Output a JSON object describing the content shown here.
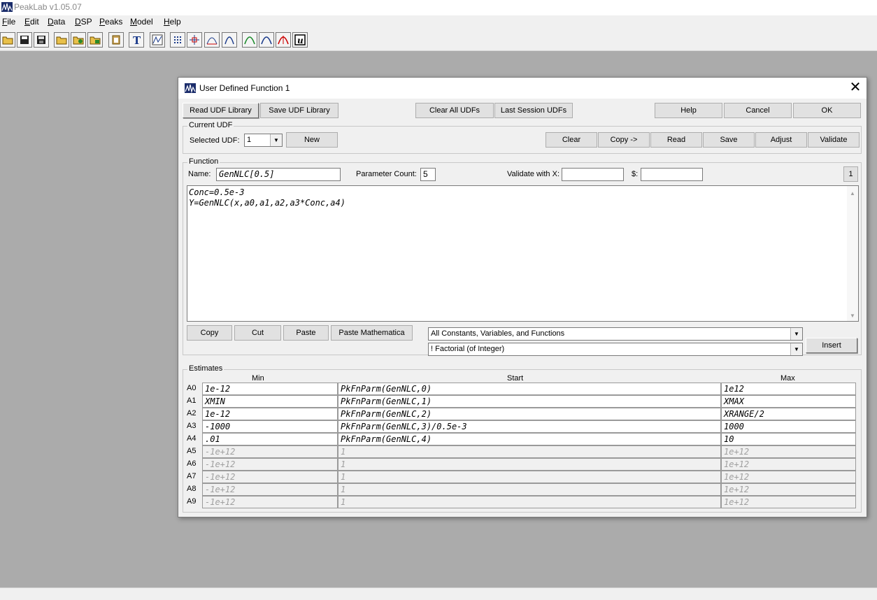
{
  "app": {
    "title": "PeakLab v1.05.07"
  },
  "menu": [
    {
      "label": "File",
      "ul": "F",
      "rest": "ile"
    },
    {
      "label": "Edit",
      "ul": "E",
      "rest": "dit"
    },
    {
      "label": "Data",
      "ul": "D",
      "rest": "ata"
    },
    {
      "label": "DSP",
      "ul": "D",
      "rest": "SP"
    },
    {
      "label": "Peaks",
      "ul": "P",
      "rest": "eaks"
    },
    {
      "label": "Model",
      "ul": "M",
      "rest": "odel"
    },
    {
      "label": "Help",
      "ul": "H",
      "rest": "elp"
    }
  ],
  "toolbar_icons": [
    "open-folder-icon",
    "save-disk-icon",
    "save-all-icon",
    "open-file-icon",
    "open-data-icon",
    "open-workspace-icon",
    "clipboard-icon",
    "text-tool-icon",
    "chart-view-icon",
    "grid-points-icon",
    "crosshair-icon",
    "baseline-peak-icon",
    "single-peak-icon",
    "gaussian-peak-icon",
    "peak-fit-icon",
    "red-peak-icon",
    "udf-icon"
  ],
  "dialog": {
    "title": "User Defined Function 1",
    "top_buttons": {
      "read_library": "Read UDF Library",
      "save_library": "Save UDF Library",
      "clear_all": "Clear All UDFs",
      "last_session": "Last Session UDFs",
      "help": "Help",
      "cancel": "Cancel",
      "ok": "OK"
    },
    "current_udf": {
      "legend": "Current UDF",
      "selected_label": "Selected UDF:",
      "selected_value": "1",
      "new": "New",
      "clear": "Clear",
      "copy": "Copy ->",
      "read": "Read",
      "save": "Save",
      "adjust": "Adjust",
      "validate": "Validate"
    },
    "function": {
      "legend": "Function",
      "name_label": "Name:",
      "name_value": "GenNLC[0.5]",
      "param_count_label": "Parameter Count:",
      "param_count_value": "5",
      "validate_x_label": "Validate with X:",
      "validate_x_value": "",
      "dollar_label": "$:",
      "dollar_value": "",
      "page_button": "1",
      "code_lines": [
        "Conc=0.5e-3",
        "Y=GenNLC(x,a0,a1,a2,a3*Conc,a4)"
      ],
      "copy": "Copy",
      "cut": "Cut",
      "paste": "Paste",
      "paste_mathematica": "Paste Mathematica",
      "category_select": "All Constants, Variables, and Functions",
      "item_select": "! Factorial (of Integer)",
      "insert": "Insert"
    },
    "estimates": {
      "legend": "Estimates",
      "headers": {
        "min": "Min",
        "start": "Start",
        "max": "Max"
      },
      "rows": [
        {
          "label": "A0",
          "min": "1e-12",
          "start": "PkFnParm(GenNLC,0)",
          "max": "1e12",
          "enabled": true
        },
        {
          "label": "A1",
          "min": "XMIN",
          "start": "PkFnParm(GenNLC,1)",
          "max": "XMAX",
          "enabled": true
        },
        {
          "label": "A2",
          "min": "1e-12",
          "start": "PkFnParm(GenNLC,2)",
          "max": "XRANGE/2",
          "enabled": true
        },
        {
          "label": "A3",
          "min": "-1000",
          "start": "PkFnParm(GenNLC,3)/0.5e-3",
          "max": "1000",
          "enabled": true
        },
        {
          "label": "A4",
          "min": ".01",
          "start": "PkFnParm(GenNLC,4)",
          "max": "10",
          "enabled": true
        },
        {
          "label": "A5",
          "min": "-1e+12",
          "start": "1",
          "max": "1e+12",
          "enabled": false
        },
        {
          "label": "A6",
          "min": "-1e+12",
          "start": "1",
          "max": "1e+12",
          "enabled": false
        },
        {
          "label": "A7",
          "min": "-1e+12",
          "start": "1",
          "max": "1e+12",
          "enabled": false
        },
        {
          "label": "A8",
          "min": "-1e+12",
          "start": "1",
          "max": "1e+12",
          "enabled": false
        },
        {
          "label": "A9",
          "min": "-1e+12",
          "start": "1",
          "max": "1e+12",
          "enabled": false
        }
      ]
    }
  }
}
